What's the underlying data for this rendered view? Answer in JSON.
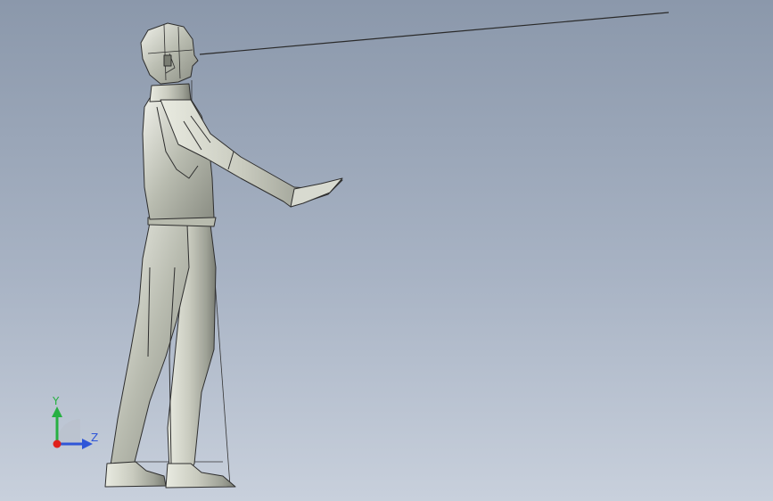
{
  "viewport": {
    "background_top": "#8b98ab",
    "background_bottom": "#c8d0dc",
    "model_color": "#c8cabe",
    "edge_color": "#2e2e2e"
  },
  "triad": {
    "y_label": "Y",
    "z_label": "Z",
    "y_color": "#27b042",
    "z_color": "#2f56d8",
    "x_color": "#e0201b"
  }
}
